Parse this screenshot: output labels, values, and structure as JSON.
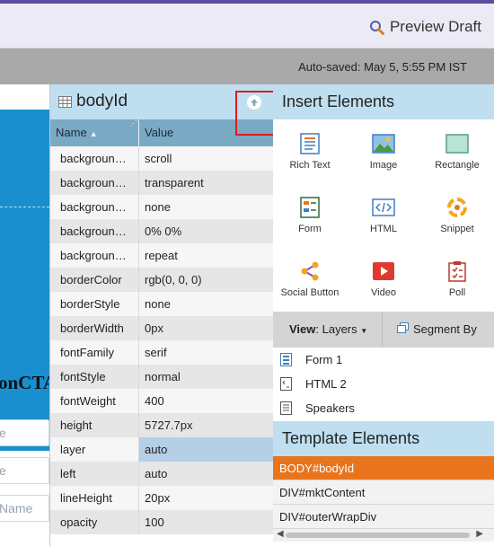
{
  "top_bar": {
    "preview_label": "Preview Draft"
  },
  "status": {
    "autosaved": "Auto-saved: May 5, 5:55 PM IST"
  },
  "canvas": {
    "cta_text": "onCTA",
    "input1_placeholder": "e",
    "input2_placeholder": "e",
    "input3_placeholder": "Name"
  },
  "properties": {
    "title": "bodyId",
    "col_name": "Name",
    "col_value": "Value",
    "rows": [
      {
        "name": "backgroun…",
        "value": "scroll"
      },
      {
        "name": "backgroun…",
        "value": "transparent"
      },
      {
        "name": "backgroun…",
        "value": "none"
      },
      {
        "name": "backgroun…",
        "value": "0% 0%"
      },
      {
        "name": "backgroun…",
        "value": "repeat"
      },
      {
        "name": "borderColor",
        "value": "rgb(0, 0, 0)"
      },
      {
        "name": "borderStyle",
        "value": "none"
      },
      {
        "name": "borderWidth",
        "value": "0px"
      },
      {
        "name": "fontFamily",
        "value": "serif"
      },
      {
        "name": "fontStyle",
        "value": "normal"
      },
      {
        "name": "fontWeight",
        "value": "400"
      },
      {
        "name": "height",
        "value": "5727.7px"
      },
      {
        "name": "layer",
        "value": "auto"
      },
      {
        "name": "left",
        "value": "auto"
      },
      {
        "name": "lineHeight",
        "value": "20px"
      },
      {
        "name": "opacity",
        "value": "100"
      }
    ]
  },
  "insert": {
    "title": "Insert Elements",
    "items": [
      {
        "label": "Rich Text",
        "icon": "rich-text-icon"
      },
      {
        "label": "Image",
        "icon": "image-icon"
      },
      {
        "label": "Rectangle",
        "icon": "rectangle-icon"
      },
      {
        "label": "Form",
        "icon": "form-icon"
      },
      {
        "label": "HTML",
        "icon": "html-icon"
      },
      {
        "label": "Snippet",
        "icon": "snippet-icon"
      },
      {
        "label": "Social Button",
        "icon": "social-button-icon"
      },
      {
        "label": "Video",
        "icon": "video-icon"
      },
      {
        "label": "Poll",
        "icon": "poll-icon"
      }
    ]
  },
  "view_bar": {
    "view_label": "View",
    "view_value": ": Layers",
    "segment_label": "Segment By"
  },
  "layers": [
    {
      "label": "Form 1"
    },
    {
      "label": "HTML 2"
    },
    {
      "label": "Speakers"
    }
  ],
  "template": {
    "title": "Template Elements",
    "items": [
      {
        "label": "BODY#bodyId"
      },
      {
        "label": "DIV#mktContent"
      },
      {
        "label": "DIV#outerWrapDiv"
      }
    ]
  },
  "colors": {
    "accent_orange": "#e8751d",
    "panel_header": "#bfdff0",
    "canvas_blue": "#1a8fd0",
    "highlight_red": "#e01b1b"
  }
}
